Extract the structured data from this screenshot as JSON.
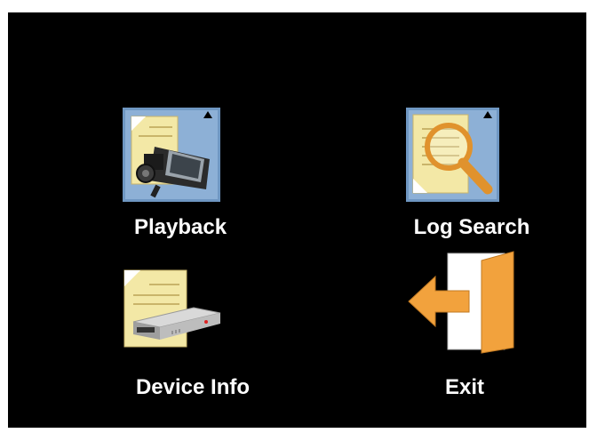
{
  "menu": {
    "items": [
      {
        "label": "Playback",
        "icon": "playback-camera-icon"
      },
      {
        "label": "Log Search",
        "icon": "log-search-magnifier-icon"
      },
      {
        "label": "Device Info",
        "icon": "device-info-dvr-icon"
      },
      {
        "label": "Exit",
        "icon": "exit-door-icon"
      }
    ]
  },
  "colors": {
    "background": "#000000",
    "text": "#ffffff",
    "icon_frame": "#6f97c2",
    "paper": "#f3e8a6",
    "accent_orange": "#f2a23d"
  }
}
